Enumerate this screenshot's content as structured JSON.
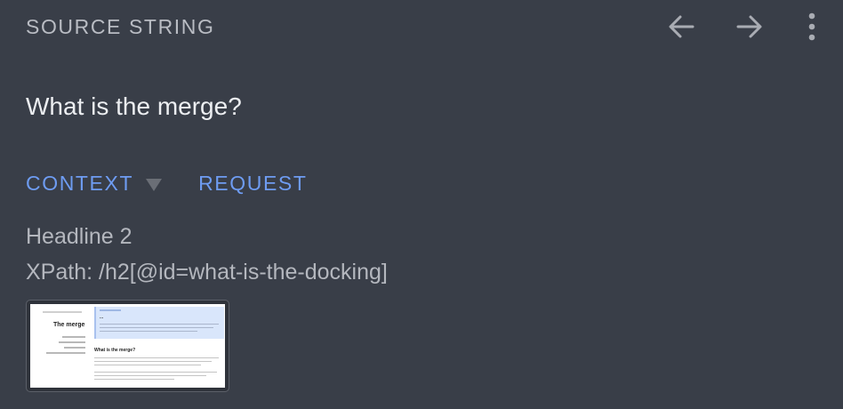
{
  "header": {
    "section_label": "SOURCE STRING",
    "actions": [
      {
        "name": "previous",
        "icon": "arrow-left-icon"
      },
      {
        "name": "next",
        "icon": "arrow-right-icon"
      },
      {
        "name": "more",
        "icon": "more-vertical-icon"
      }
    ]
  },
  "source": {
    "text": "What is the merge?"
  },
  "tabs": [
    {
      "label": "CONTEXT",
      "has_dropdown": true,
      "active": true
    },
    {
      "label": "REQUEST",
      "has_dropdown": false,
      "active": false
    }
  ],
  "context": {
    "element_type": "Headline 2",
    "xpath": "XPath: /h2[@id=what-is-the-docking]"
  },
  "screenshot_thumbnail": {
    "page_title": "The merge",
    "hero_title": "...",
    "section_heading": "What is the merge?"
  },
  "colors": {
    "background": "#393e48",
    "accent": "#6e9cf2",
    "primary_text": "#eceef1",
    "secondary_text": "#b4b7be",
    "icon": "#a9acb3"
  }
}
